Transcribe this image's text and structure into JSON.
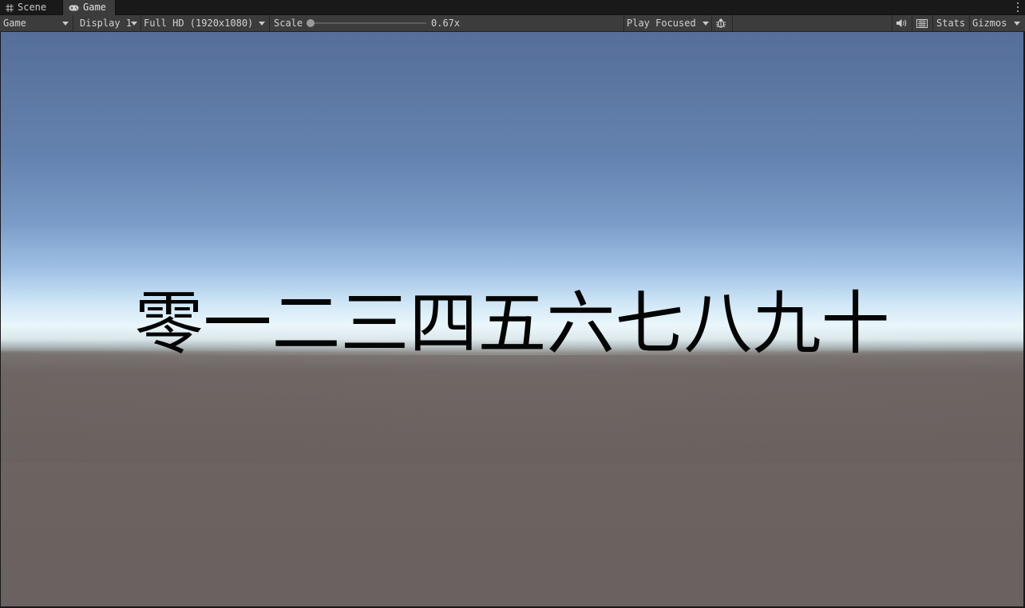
{
  "tabs": {
    "scene": {
      "label": "Scene",
      "icon": "grid-icon"
    },
    "game": {
      "label": "Game",
      "icon": "gamepad-icon"
    }
  },
  "toolbar": {
    "view_dropdown": "Game",
    "display_dropdown": "Display 1",
    "resolution_dropdown": "Full HD (1920x1080)",
    "scale_label": "Scale",
    "scale_value": "0.67x",
    "scale_level": 0.0,
    "play_mode_dropdown": "Play Focused",
    "bug_icon": "bug-icon",
    "audio_icon": "speaker-icon",
    "keyboard_icon": "keyboard-icon",
    "stats_label": "Stats",
    "gizmos_label": "Gizmos"
  },
  "game_view": {
    "text": "零一二三四五六七八九十"
  },
  "colors": {
    "toolbar_bg": "#3c3c3c",
    "tabstrip_bg": "#191919",
    "sky_top": "#556e9a",
    "horizon": "#e9f6fb",
    "ground": "#6a6260"
  }
}
